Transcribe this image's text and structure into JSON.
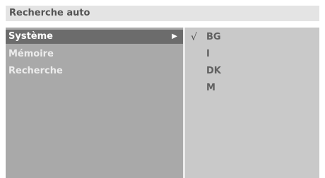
{
  "header": {
    "title": "Recherche auto"
  },
  "menu": {
    "items": [
      {
        "label": "Système",
        "selected": true,
        "has_submenu": true
      },
      {
        "label": "Mémoire",
        "selected": false
      },
      {
        "label": "Recherche",
        "selected": false
      }
    ],
    "submenu_arrow": "▶"
  },
  "submenu": {
    "check_mark": "√",
    "options": [
      {
        "label": "BG",
        "checked": true
      },
      {
        "label": "I",
        "checked": false
      },
      {
        "label": "DK",
        "checked": false
      },
      {
        "label": "M",
        "checked": false
      }
    ]
  },
  "colors": {
    "title_bar": "#e4e4e4",
    "left_panel": "#a9a9a9",
    "right_panel": "#c9c9c9",
    "selected_row": "#6c6c6c"
  }
}
